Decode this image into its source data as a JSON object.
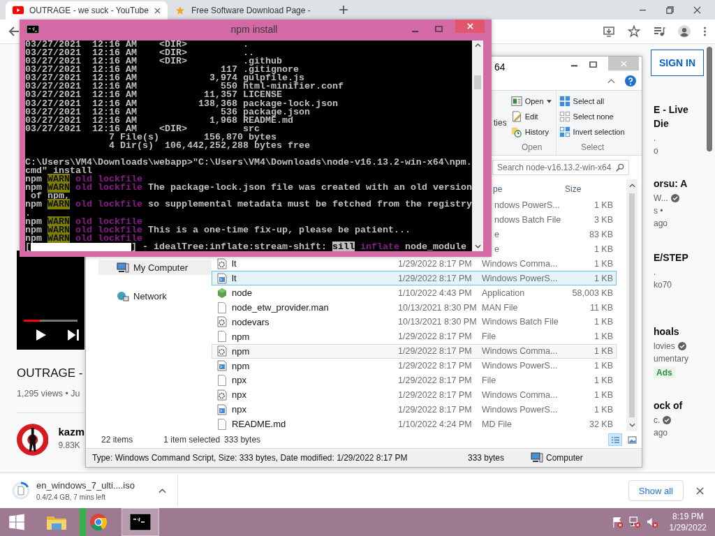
{
  "browser": {
    "tabs": [
      {
        "title": "OUTRAGE - we suck - YouTube",
        "selected": true,
        "kind": "youtube"
      },
      {
        "title": "Free Software Download Page - ",
        "selected": false,
        "kind": "star"
      }
    ],
    "sign_in": "SIGN IN",
    "video": {
      "level": 0.3
    },
    "video_title": "OUTRAGE -",
    "video_meta": "1,295 views • Ju",
    "channel": {
      "name": "kazm",
      "subscribers": "9.83K"
    },
    "sidebar": [
      {
        "title": [
          "E - Live",
          "Die"
        ],
        "meta": [
          {
            "text": "."
          },
          {
            "text": "o"
          }
        ]
      },
      {
        "title": [
          "orsu: A"
        ],
        "meta": [
          {
            "text": "W...",
            "verified": true
          },
          {
            "text": "s •"
          },
          {
            "text": "ago"
          }
        ]
      },
      {
        "title": [
          "E/STEP"
        ],
        "meta": [
          {
            "text": "."
          },
          {
            "text": "ko70"
          }
        ]
      },
      {
        "title": [
          "hoals"
        ],
        "meta": [
          {
            "text": "lovies",
            "verified": true
          },
          {
            "text": "umentary"
          }
        ],
        "badge": "Ads"
      },
      {
        "title": [
          "ock of"
        ],
        "meta": [
          {
            "text": "c.",
            "verified": true
          },
          {
            "text": "ago"
          }
        ]
      }
    ],
    "download": {
      "file": "en_windows_7_ulti....iso",
      "status": "0.4/2.4 GB, 7 mins left",
      "level": 0.17,
      "show_all": "Show all"
    }
  },
  "terminal": {
    "title": "npm install",
    "lines": [
      {
        "kind": "text",
        "segments": [
          {
            "text": "03/27/2021  12:16 AM    <DIR>          .",
            "kind": "normal"
          }
        ]
      },
      {
        "kind": "text",
        "segments": [
          {
            "text": "03/27/2021  12:16 AM    <DIR>          ..",
            "kind": "normal"
          }
        ]
      },
      {
        "kind": "text",
        "segments": [
          {
            "text": "03/27/2021  12:16 AM    <DIR>          .github",
            "kind": "normal"
          }
        ]
      },
      {
        "kind": "text",
        "segments": [
          {
            "text": "03/27/2021  12:16 AM               117 .gitignore",
            "kind": "normal"
          }
        ]
      },
      {
        "kind": "text",
        "segments": [
          {
            "text": "03/27/2021  12:16 AM             3,974 gulpfile.js",
            "kind": "normal"
          }
        ]
      },
      {
        "kind": "text",
        "segments": [
          {
            "text": "03/27/2021  12:16 AM               550 html-minifier.conf",
            "kind": "normal"
          }
        ]
      },
      {
        "kind": "text",
        "segments": [
          {
            "text": "03/27/2021  12:16 AM            11,357 LICENSE",
            "kind": "normal"
          }
        ]
      },
      {
        "kind": "text",
        "segments": [
          {
            "text": "03/27/2021  12:16 AM           138,368 package-lock.json",
            "kind": "normal"
          }
        ]
      },
      {
        "kind": "text",
        "segments": [
          {
            "text": "03/27/2021  12:16 AM               536 package.json",
            "kind": "normal"
          }
        ]
      },
      {
        "kind": "text",
        "segments": [
          {
            "text": "03/27/2021  12:16 AM             1,968 README.md",
            "kind": "normal"
          }
        ]
      },
      {
        "kind": "text",
        "segments": [
          {
            "text": "03/27/2021  12:16 AM    <DIR>          src",
            "kind": "normal"
          }
        ]
      },
      {
        "kind": "text",
        "segments": [
          {
            "text": "               7 File(s)        156,870 bytes",
            "kind": "normal"
          }
        ]
      },
      {
        "kind": "text",
        "segments": [
          {
            "text": "               4 Dir(s)  106,442,252,288 bytes free",
            "kind": "normal"
          }
        ]
      },
      {
        "kind": "blank"
      },
      {
        "kind": "text",
        "segments": [
          {
            "text": "C:\\Users\\VM4\\Downloads\\webapp>\"C:\\Users\\VM4\\Downloads\\node-v16.13.2-win-x64\\npm.",
            "kind": "normal"
          }
        ]
      },
      {
        "kind": "text",
        "segments": [
          {
            "text": "cmd\" install",
            "kind": "normal"
          }
        ]
      },
      {
        "kind": "text",
        "segments": [
          {
            "text": "npm ",
            "kind": "normal"
          },
          {
            "text": "WARN",
            "kind": "warn"
          },
          {
            "text": " old lockfile",
            "kind": "magenta"
          }
        ]
      },
      {
        "kind": "text",
        "segments": [
          {
            "text": "npm ",
            "kind": "normal"
          },
          {
            "text": "WARN",
            "kind": "warn"
          },
          {
            "text": " old lockfile",
            "kind": "magenta"
          },
          {
            "text": " The package-lock.json file was created with an old version",
            "kind": "normal"
          }
        ]
      },
      {
        "kind": "text",
        "segments": [
          {
            "text": " of npm,",
            "kind": "normal"
          }
        ]
      },
      {
        "kind": "text",
        "segments": [
          {
            "text": "npm ",
            "kind": "normal"
          },
          {
            "text": "WARN",
            "kind": "warn"
          },
          {
            "text": " old lockfile",
            "kind": "magenta"
          },
          {
            "text": " so supplemental metadata must be fetched from the registry",
            "kind": "normal"
          }
        ]
      },
      {
        "kind": "text",
        "segments": [
          {
            "text": ".",
            "kind": "normal"
          }
        ]
      },
      {
        "kind": "text",
        "segments": [
          {
            "text": "npm ",
            "kind": "normal"
          },
          {
            "text": "WARN",
            "kind": "warn"
          },
          {
            "text": " old lockfile",
            "kind": "magenta"
          }
        ]
      },
      {
        "kind": "text",
        "segments": [
          {
            "text": "npm ",
            "kind": "normal"
          },
          {
            "text": "WARN",
            "kind": "warn"
          },
          {
            "text": " old lockfile",
            "kind": "magenta"
          },
          {
            "text": " This is a one-time fix-up, please be patient...",
            "kind": "normal"
          }
        ]
      },
      {
        "kind": "text",
        "segments": [
          {
            "text": "npm ",
            "kind": "normal"
          },
          {
            "text": "WARN",
            "kind": "warn"
          },
          {
            "text": " old lockfile",
            "kind": "magenta"
          }
        ]
      },
      {
        "kind": "progress",
        "prefix": "[",
        "level": 1,
        "segments": [
          {
            "text": "] - idealTree:inflate:stream-shift: ",
            "kind": "normal"
          },
          {
            "text": "sill",
            "kind": "inverse"
          },
          {
            "text": " inflate",
            "kind": "magenta"
          },
          {
            "text": " node_module",
            "kind": "normal"
          }
        ]
      }
    ]
  },
  "explorer": {
    "title": "64",
    "ribbon_fragment": "ties",
    "ribbon_groups": [
      {
        "label": "Open",
        "items": [
          {
            "label": "Open",
            "kind": "open",
            "dropdown": true
          },
          {
            "label": "Edit",
            "kind": "edit"
          },
          {
            "label": "History",
            "kind": "history"
          }
        ]
      },
      {
        "label": "Select",
        "items": [
          {
            "label": "Select all",
            "kind": "select-all"
          },
          {
            "label": "Select none",
            "kind": "select-none"
          },
          {
            "label": "Invert selection",
            "kind": "invert"
          }
        ]
      }
    ],
    "search": {
      "placeholder": "Search node-v16.13.2-win-x64"
    },
    "type_header": "pe",
    "size_header": "Size",
    "nav": [
      {
        "label": "My Computer",
        "kind": "computer",
        "selected": true
      },
      {
        "label": "Network",
        "kind": "network",
        "selected": false
      }
    ],
    "rows": [
      {
        "kind": "partial",
        "type": "ndows PowerS...",
        "size": "1 KB",
        "selected": false,
        "hovered": false
      },
      {
        "kind": "partial",
        "type": "ndows Batch File",
        "size": "3 KB",
        "selected": false,
        "hovered": false
      },
      {
        "kind": "partial",
        "type": "e",
        "size": "83 KB",
        "selected": false,
        "hovered": false
      },
      {
        "kind": "partial",
        "type": "e",
        "size": "1 KB",
        "selected": false,
        "hovered": false
      },
      {
        "kind": "cmd",
        "name": "lt",
        "date": "1/29/2022 8:17 PM",
        "type": "Windows Comma...",
        "size": "1 KB",
        "selected": false,
        "hovered": false
      },
      {
        "kind": "ps",
        "name": "lt",
        "date": "1/29/2022 8:17 PM",
        "type": "Windows PowerS...",
        "size": "1 KB",
        "selected": false,
        "hovered": true
      },
      {
        "kind": "app",
        "name": "node",
        "date": "1/10/2022 4:43 PM",
        "type": "Application",
        "size": "58,003 KB",
        "selected": false,
        "hovered": false
      },
      {
        "kind": "file",
        "name": "node_etw_provider.man",
        "date": "10/13/2021 8:30 PM",
        "type": "MAN File",
        "size": "11 KB",
        "selected": false,
        "hovered": false
      },
      {
        "kind": "cmd",
        "name": "nodevars",
        "date": "10/13/2021 8:30 PM",
        "type": "Windows Batch File",
        "size": "1 KB",
        "selected": false,
        "hovered": false
      },
      {
        "kind": "file",
        "name": "npm",
        "date": "1/29/2022 8:17 PM",
        "type": "File",
        "size": "1 KB",
        "selected": false,
        "hovered": false
      },
      {
        "kind": "cmd",
        "name": "npm",
        "date": "1/29/2022 8:17 PM",
        "type": "Windows Comma...",
        "size": "1 KB",
        "selected": true,
        "hovered": false
      },
      {
        "kind": "ps",
        "name": "npm",
        "date": "1/29/2022 8:17 PM",
        "type": "Windows PowerS...",
        "size": "1 KB",
        "selected": false,
        "hovered": false
      },
      {
        "kind": "file",
        "name": "npx",
        "date": "1/29/2022 8:17 PM",
        "type": "File",
        "size": "1 KB",
        "selected": false,
        "hovered": false
      },
      {
        "kind": "cmd",
        "name": "npx",
        "date": "1/29/2022 8:17 PM",
        "type": "Windows Comma...",
        "size": "1 KB",
        "selected": false,
        "hovered": false
      },
      {
        "kind": "ps",
        "name": "npx",
        "date": "1/29/2022 8:17 PM",
        "type": "Windows PowerS...",
        "size": "1 KB",
        "selected": false,
        "hovered": false
      },
      {
        "kind": "file",
        "name": "README.md",
        "date": "1/10/2022 4:24 PM",
        "type": "MD File",
        "size": "32 KB",
        "selected": false,
        "hovered": false
      }
    ],
    "status": {
      "count": "22 items",
      "selection": "1 item selected",
      "selection_size": "333 bytes"
    },
    "views": [
      {
        "kind": "details",
        "selected": true
      },
      {
        "kind": "tiles",
        "selected": false
      }
    ],
    "details": {
      "text": "Type: Windows Command Script, Size: 333 bytes, Date modified: 1/29/2022 8:17 PM",
      "size": "333 bytes",
      "location": "Computer"
    }
  },
  "taskbar": {
    "items": [
      {
        "kind": "start"
      },
      {
        "kind": "explorer",
        "active": false
      },
      {
        "kind": "chrome",
        "active": false,
        "level": 0.17
      },
      {
        "kind": "cmd",
        "active": true
      }
    ],
    "tray": [
      {
        "kind": "flag"
      },
      {
        "kind": "network"
      },
      {
        "kind": "volume"
      }
    ],
    "time": "8:19 PM",
    "date": "1/29/2022"
  }
}
